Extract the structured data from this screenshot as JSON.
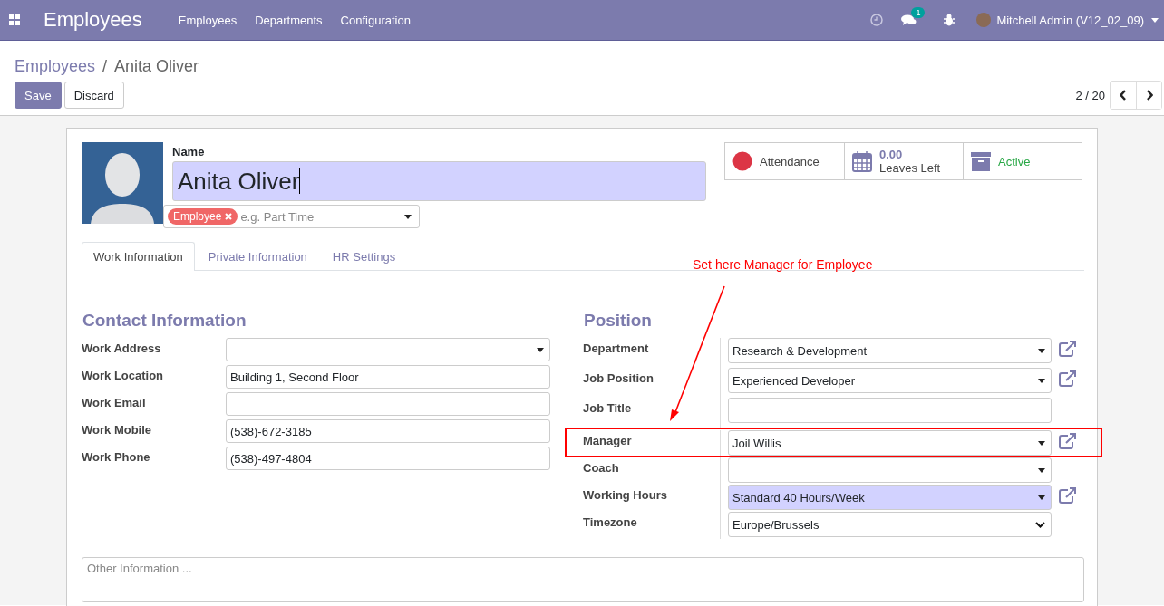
{
  "topbar": {
    "app_name": "Employees",
    "menu": [
      "Employees",
      "Departments",
      "Configuration"
    ],
    "message_count": "1",
    "user": "Mitchell Admin (V12_02_09)"
  },
  "breadcrumb": {
    "parent": "Employees",
    "separator": "/",
    "current": "Anita Oliver"
  },
  "buttons": [
    {
      "label": "Save",
      "primary": true
    },
    {
      "label": "Discard",
      "primary": false
    }
  ],
  "pager": "2 / 20",
  "employee": {
    "name_label": "Name",
    "name": "Anita Oliver",
    "tags": [
      {
        "label": "Employee",
        "color": "#f06767"
      }
    ],
    "tags_placeholder": "e.g. Part Time"
  },
  "stat_buttons": [
    {
      "kind": "attendance",
      "label": "Attendance"
    },
    {
      "kind": "leaves",
      "value": "0.00",
      "label": "Leaves Left"
    },
    {
      "kind": "active",
      "label": "Active"
    }
  ],
  "tabs": [
    {
      "label": "Work Information",
      "selected": true
    },
    {
      "label": "Private Information",
      "selected": false
    },
    {
      "label": "HR Settings",
      "selected": false
    }
  ],
  "annotation": "Set here Manager for Employee",
  "contact": {
    "title": "Contact Information",
    "fields": [
      {
        "label": "Work Address",
        "kind": "select"
      },
      {
        "label": "Work Location",
        "kind": "text",
        "value": "Building 1, Second Floor"
      },
      {
        "label": "Work Email",
        "kind": "text"
      },
      {
        "label": "Work Mobile",
        "kind": "text",
        "value": "(538)-672-3185"
      },
      {
        "label": "Work Phone",
        "kind": "text",
        "value": "(538)-497-4804"
      }
    ]
  },
  "position": {
    "title": "Position",
    "fields": [
      {
        "label": "Department",
        "kind": "select",
        "value": "Research & Development",
        "required": false,
        "link": true,
        "highlighted": false
      },
      {
        "label": "Job Position",
        "kind": "select",
        "value": "Experienced Developer",
        "required": false,
        "link": true,
        "highlighted": false
      },
      {
        "label": "Job Title",
        "kind": "text",
        "required": false,
        "link": false,
        "highlighted": false
      },
      {
        "label": "Manager",
        "kind": "select",
        "value": "Joil Willis",
        "required": false,
        "link": true,
        "highlighted": true
      },
      {
        "label": "Coach",
        "kind": "select",
        "required": false,
        "link": false,
        "highlighted": false
      },
      {
        "label": "Working Hours",
        "kind": "select",
        "value": "Standard 40 Hours/Week",
        "required": true,
        "link": true,
        "highlighted": false
      },
      {
        "label": "Timezone",
        "kind": "native",
        "value": "Europe/Brussels",
        "required": false,
        "link": false,
        "highlighted": false
      }
    ]
  },
  "notes": {
    "placeholder": "Other Information ..."
  }
}
